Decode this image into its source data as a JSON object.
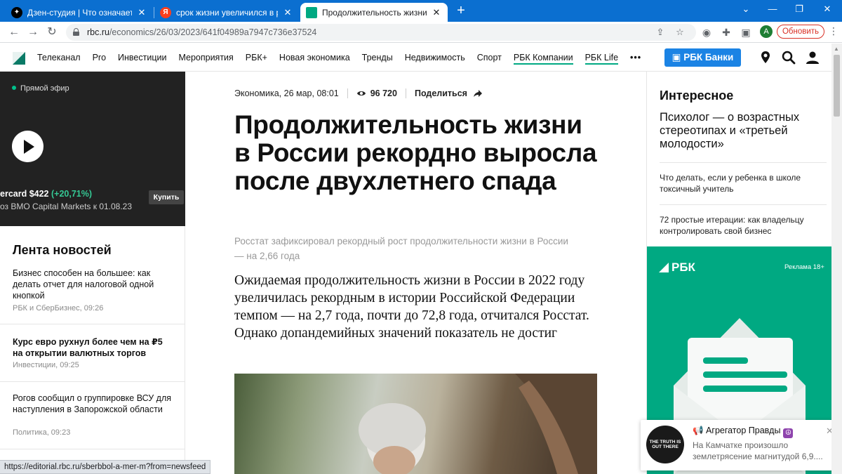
{
  "browser": {
    "tabs": [
      {
        "title": "Дзен-студия | Что означает рос",
        "favicon": "zen-favicon",
        "active": false
      },
      {
        "title": "срок жизни увеличился в росси",
        "favicon": "yandex-favicon",
        "active": false
      },
      {
        "title": "Продолжительность жизни в Ро",
        "favicon": "rbc-favicon",
        "active": true
      }
    ],
    "url_domain": "rbc.ru",
    "url_path": "/economics/26/03/2023/641f04989a7947c736e37524",
    "profile_initial": "A",
    "update_label": "Обновить",
    "status_url": "https://editorial.rbc.ru/sberbbol-a-mer-m?from=newsfeed"
  },
  "site": {
    "nav": [
      {
        "label": "Телеканал",
        "underline": false
      },
      {
        "label": "Pro",
        "underline": false
      },
      {
        "label": "Инвестиции",
        "underline": false
      },
      {
        "label": "Мероприятия",
        "underline": false
      },
      {
        "label": "РБК+",
        "underline": false
      },
      {
        "label": "Новая экономика",
        "underline": false
      },
      {
        "label": "Тренды",
        "underline": false
      },
      {
        "label": "Недвижимость",
        "underline": false
      },
      {
        "label": "Спорт",
        "underline": false
      },
      {
        "label": "РБК Компании",
        "underline": true
      },
      {
        "label": "РБК Life",
        "underline": true
      }
    ],
    "nav_more": "•••",
    "bank_button": "РБК Банки"
  },
  "player": {
    "live_label": "Прямой эфир",
    "ticker_name": "ercard $422",
    "ticker_change": "(+20,71%)",
    "ticker_sub": "оз BMO Capital Markets к 01.08.23",
    "buy_label": "Купить"
  },
  "feed": {
    "title": "Лента новостей",
    "items": [
      {
        "text": "Бизнес способен на большее: как делать отчет для налоговой одной кнопкой",
        "meta": "РБК и СберБизнес, 09:26",
        "bold": false
      },
      {
        "text": "Курс евро рухнул более чем на ₽5 на открытии валютных торгов",
        "meta": "Инвестиции, 09:25",
        "bold": true
      },
      {
        "text": "Рогов сообщил о группировке ВСУ для наступления в Запорожской области",
        "meta": "Политика, 09:23",
        "bold": false
      }
    ]
  },
  "article": {
    "meta_date": "Экономика, 26 мар, 08:01",
    "views": "96 720",
    "share_label": "Поделиться",
    "headline": "Продолжительность жизни в России рекордно выросла после двухлетнего спада",
    "lead": "Росстат зафиксировал рекордный рост продолжительности жизни в России — на 2,66 года",
    "intro": "Ожидаемая продолжительность жизни в России в 2022 году увеличилась рекордным в истории Российской Федерации темпом — на 2,7 года, почти до 72,8 года, отчитался Росстат. Однако допандемийных значений показатель не достиг"
  },
  "sidebar": {
    "title": "Интересное",
    "featured": "Психолог — о возрастных стереотипах и «третьей молодости»",
    "items": [
      "Что делать, если у ребенка в школе токсичный учитель",
      "72 простые итерации: как владельцу контролировать свой бизнес"
    ],
    "ad_logo": "РБК",
    "ad_tag": "Реклама 18+"
  },
  "notification": {
    "title": "Агрегатор Правды",
    "avatar_text": "THE TRUTH IS OUT THERE",
    "text": "На Камчатке произошло землетрясение магнитудой 6,9...."
  },
  "colors": {
    "brand_green": "#00a982",
    "chrome_blue": "#0b6fd0",
    "bank_blue": "#1b83e4"
  }
}
